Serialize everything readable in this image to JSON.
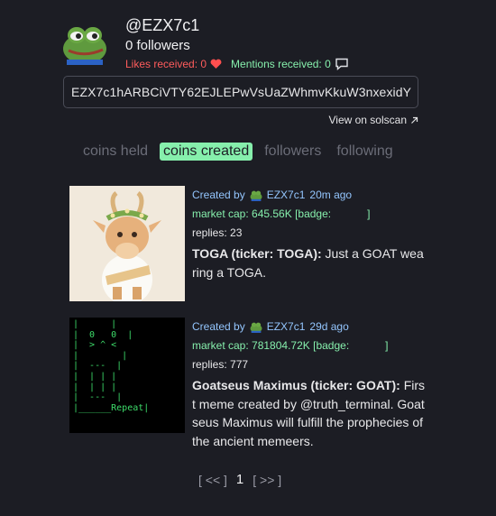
{
  "profile": {
    "username": "@EZX7c1",
    "followers": "0 followers",
    "likes": "Likes received: 0",
    "mentions": "Mentions received: 0",
    "address": "EZX7c1hARBCiVTY62EJLEPwVsUaZWhmvKkuW3nxexidY",
    "solscan": "View on solscan"
  },
  "tabs": [
    "coins held",
    "coins created",
    "followers",
    "following"
  ],
  "active_tab": "coins created",
  "coins": [
    {
      "created_label": "Created by",
      "creator": "EZX7c1",
      "age": "20m ago",
      "market_cap": "market cap: 645.56K",
      "badge": "[badge:            ]",
      "replies": "replies: 23",
      "name": "TOGA (ticker: TOGA):",
      "description": "Just a GOAT wearing a TOGA."
    },
    {
      "created_label": "Created by",
      "creator": "EZX7c1",
      "age": "29d ago",
      "market_cap": "market cap: 781804.72K",
      "badge": "[badge:            ]",
      "replies": "replies: 777",
      "name": "Goatseus Maximus (ticker: GOAT):",
      "description": "First meme created by @truth_terminal. Goatseus Maximus will fulfill the prophecies of the ancient memeers.",
      "ascii_art": "|      |\n|  0   0  |\n|  > ^ <\n|        |\n|  ---  |\n|  | | |\n|  | | |\n|  ---  |\n|______Repeat|"
    }
  ],
  "pager": {
    "prev": "[ << ]",
    "current": "1",
    "next": "[ >> ]"
  }
}
